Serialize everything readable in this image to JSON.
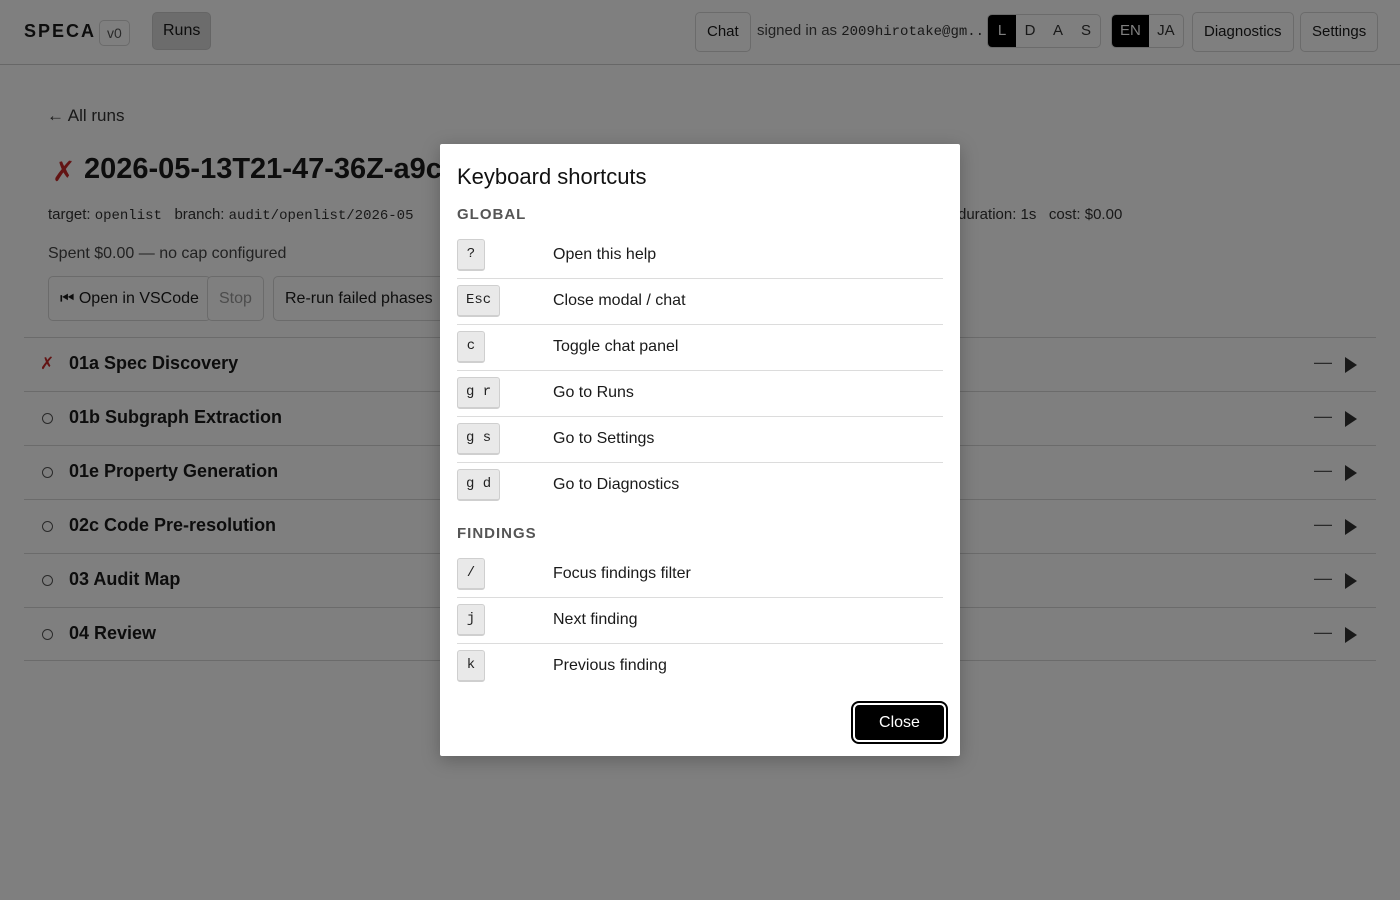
{
  "header": {
    "logo": "SPECA",
    "version": "v0",
    "nav_runs": "Runs",
    "chat": "Chat",
    "signed_prefix": "signed in as",
    "signed_user": "2009hirotake@gm...",
    "theme_options": [
      "L",
      "D",
      "A",
      "S"
    ],
    "theme_active": "L",
    "lang_options": [
      "EN",
      "JA"
    ],
    "lang_active": "EN",
    "diagnostics": "Diagnostics",
    "settings": "Settings"
  },
  "run": {
    "back": "← All runs",
    "status_icon": "✗",
    "title": "2026-05-13T21-47-36Z-a9c",
    "target_label": "target:",
    "target_value": "openlist",
    "branch_label": "branch:",
    "branch_value": "audit/openlist/2026-05",
    "duration": "duration: 1s",
    "cost": "cost: $0.00",
    "spent": "Spent $0.00 — no cap configured",
    "actions": {
      "open_vscode": "⏮ Open in VSCode",
      "stop": "Stop",
      "rerun": "Re-run failed phases"
    }
  },
  "phases": [
    {
      "name": "01a Spec Discovery",
      "status": "failed",
      "icon": "✗",
      "cost": "—"
    },
    {
      "name": "01b Subgraph Extraction",
      "status": "pending",
      "icon": "",
      "cost": "—"
    },
    {
      "name": "01e Property Generation",
      "status": "pending",
      "icon": "",
      "cost": "—"
    },
    {
      "name": "02c Code Pre-resolution",
      "status": "pending",
      "icon": "",
      "cost": "—"
    },
    {
      "name": "03 Audit Map",
      "status": "pending",
      "icon": "",
      "cost": "—"
    },
    {
      "name": "04 Review",
      "status": "pending",
      "icon": "",
      "cost": "—"
    }
  ],
  "modal": {
    "title": "Keyboard shortcuts",
    "global_label": "GLOBAL",
    "global": [
      {
        "key": "?",
        "desc": "Open this help"
      },
      {
        "key": "Esc",
        "desc": "Close modal / chat"
      },
      {
        "key": "c",
        "desc": "Toggle chat panel"
      },
      {
        "key": "g r",
        "desc": "Go to Runs"
      },
      {
        "key": "g s",
        "desc": "Go to Settings"
      },
      {
        "key": "g d",
        "desc": "Go to Diagnostics"
      }
    ],
    "findings_label": "FINDINGS",
    "findings": [
      {
        "key": "/",
        "desc": "Focus findings filter"
      },
      {
        "key": "j",
        "desc": "Next finding"
      },
      {
        "key": "k",
        "desc": "Previous finding"
      }
    ],
    "close": "Close"
  }
}
